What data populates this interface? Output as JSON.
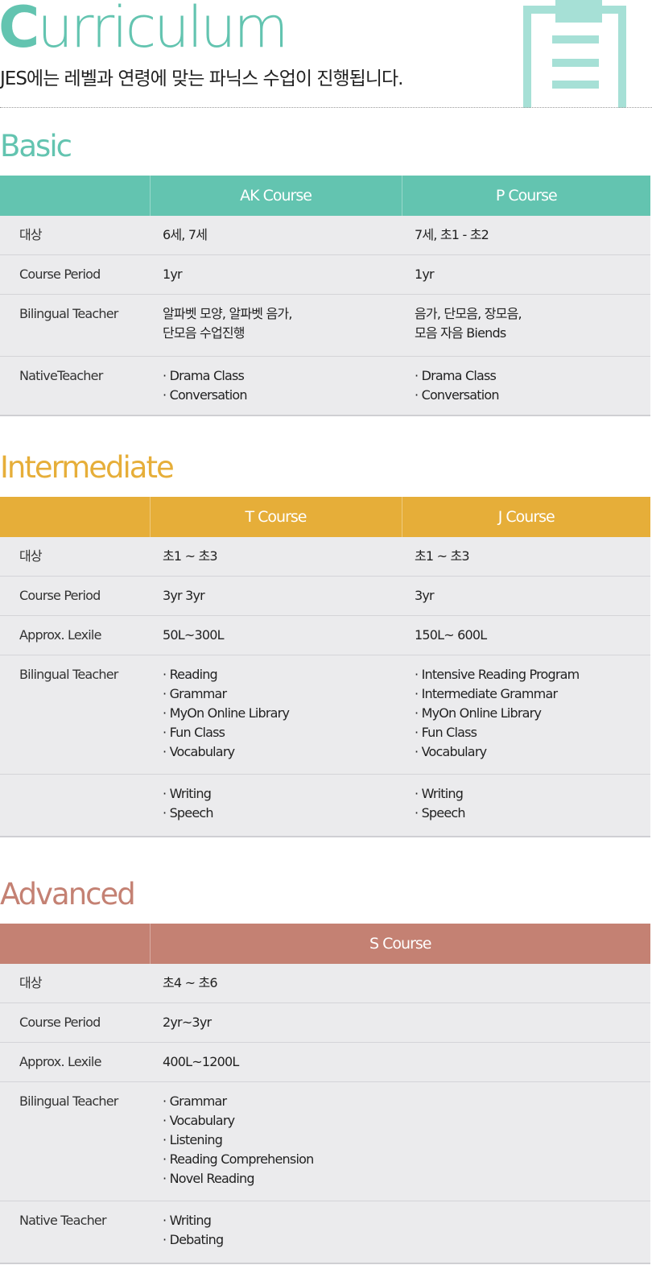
{
  "header": {
    "title_first": "C",
    "title_rest": "urriculum",
    "subtitle": "JES에는 레벨과 연령에 맞는 파닉스 수업이 진행됩니다."
  },
  "colors": {
    "basic": "#63c4b0",
    "intermediate": "#e6ae39",
    "advanced": "#c48173",
    "row_bg": "#ebebed"
  },
  "basic": {
    "title": "Basic",
    "columns": [
      "",
      "AK Course",
      "P Course"
    ],
    "rows": [
      {
        "label": "대상",
        "cells": [
          "6세, 7세",
          "7세, 초1 - 초2"
        ]
      },
      {
        "label": "Course Period",
        "cells": [
          "1yr",
          "1yr"
        ]
      },
      {
        "label": "Bilingual Teacher",
        "cells": [
          "알파벳 모양, 알파벳 음가,\n단모음 수업진행",
          "음가, 단모음, 장모음,\n모음 자음 Biends"
        ]
      },
      {
        "label": "NativeTeacher",
        "cells": [
          "· Drama Class\n· Conversation",
          "· Drama Class\n· Conversation"
        ]
      }
    ]
  },
  "intermediate": {
    "title": "Intermediate",
    "columns": [
      "",
      "T Course",
      "J Course"
    ],
    "rows": [
      {
        "label": "대상",
        "cells": [
          "초1 ~ 초3",
          "초1 ~ 초3"
        ]
      },
      {
        "label": "Course Period",
        "cells": [
          "3yr 3yr",
          "3yr"
        ]
      },
      {
        "label": "Approx. Lexile",
        "cells": [
          "50L~300L",
          "150L~ 600L"
        ]
      },
      {
        "label": "Bilingual Teacher",
        "cells": [
          "· Reading\n· Grammar\n· MyOn Online Library\n· Fun Class\n· Vocabulary",
          "· Intensive Reading Program\n· Intermediate Grammar\n· MyOn Online Library\n· Fun Class\n· Vocabulary"
        ]
      },
      {
        "label": "",
        "cells": [
          "· Writing\n· Speech",
          "· Writing\n· Speech"
        ]
      }
    ]
  },
  "advanced": {
    "title": "Advanced",
    "columns": [
      "",
      "S Course"
    ],
    "rows": [
      {
        "label": "대상",
        "cells": [
          "초4 ~ 초6"
        ]
      },
      {
        "label": "Course Period",
        "cells": [
          "2yr~3yr"
        ]
      },
      {
        "label": "Approx. Lexile",
        "cells": [
          "400L~1200L"
        ]
      },
      {
        "label": "Bilingual Teacher",
        "cells": [
          "· Grammar\n· Vocabulary\n· Listening\n· Reading Comprehension\n· Novel Reading"
        ]
      },
      {
        "label": "Native Teacher",
        "cells": [
          "· Writing\n· Debating"
        ]
      }
    ]
  }
}
